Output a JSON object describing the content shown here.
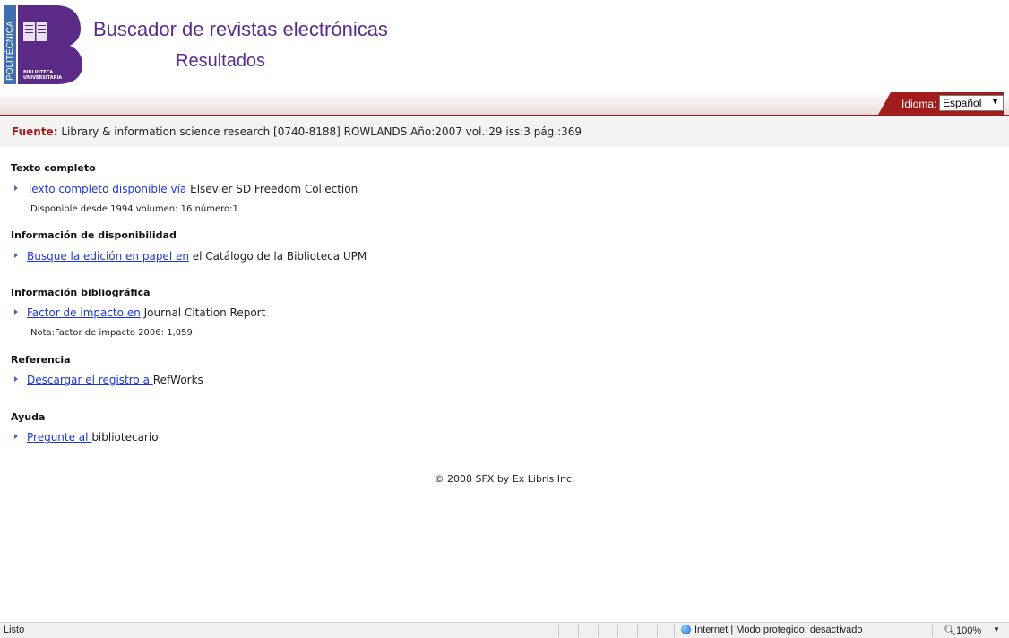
{
  "header": {
    "logo_side_text": "POLITÉCNICA",
    "logo_text_1": "BIBLIOTECA",
    "logo_text_2": "UNIVERSITARIA",
    "title": "Buscador de revistas electrónicas",
    "subtitle": "Resultados"
  },
  "language": {
    "label": "Idioma:",
    "selected": "Español"
  },
  "source": {
    "label": "Fuente:",
    "text": "Library & information science research [0740-8188] ROWLANDS Año:2007 vol.:29 iss:3 pág.:369"
  },
  "sections": {
    "fulltext": {
      "heading": "Texto completo",
      "link": "Texto completo disponible vía",
      "rest": " Elsevier SD Freedom Collection",
      "note": "Disponible desde 1994 volumen: 16 número:1"
    },
    "availability": {
      "heading": "Información de disponibilidad",
      "link": "Busque la edición en papel en",
      "rest": " el Catálogo de la Biblioteca UPM"
    },
    "bibliographic": {
      "heading": "Información bibliográfica",
      "link": "Factor de impacto en",
      "rest": " Journal Citation Report",
      "note": "Nota:Factor de impacto 2006: 1,059"
    },
    "reference": {
      "heading": "Referencia",
      "link": "Descargar el registro a ",
      "rest": "RefWorks"
    },
    "help": {
      "heading": "Ayuda",
      "link": "Pregunte al ",
      "rest": "bibliotecario"
    }
  },
  "footer": "© 2008 SFX by Ex Libris Inc.",
  "statusbar": {
    "status": "Listo",
    "zone": "Internet | Modo protegido: desactivado",
    "zoom": "100%"
  },
  "colors": {
    "brand_purple": "#5a2a91",
    "accent_red": "#9b1f1f",
    "link_blue": "#1d38d6"
  }
}
